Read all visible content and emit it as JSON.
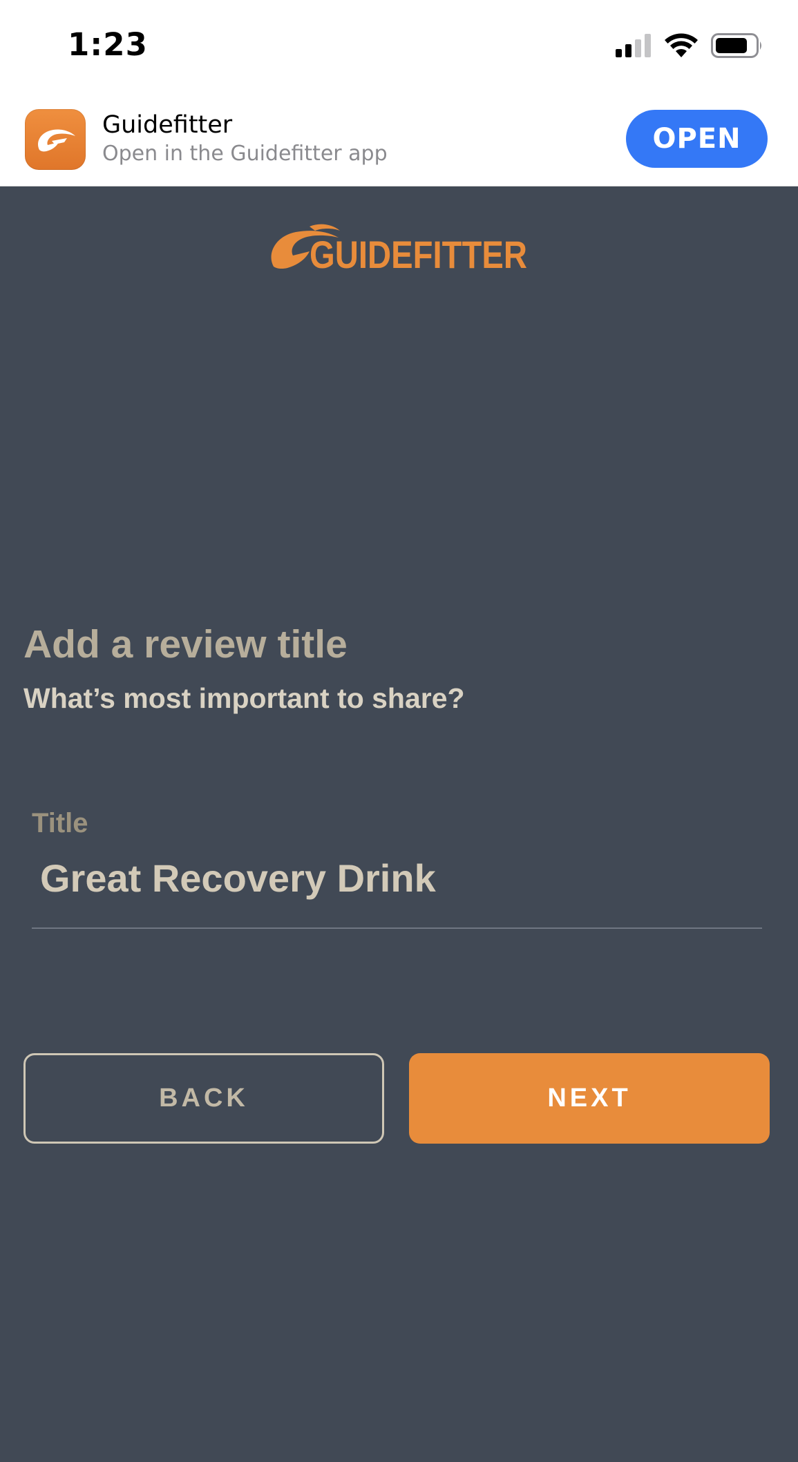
{
  "status_bar": {
    "time": "1:23"
  },
  "banner": {
    "app_name": "Guidefitter",
    "subtitle": "Open in the Guidefitter app",
    "open_label": "OPEN"
  },
  "brand": {
    "logo_text": "GUIDEFITTER",
    "accent_color": "#e88c3b",
    "background_color": "#414955"
  },
  "form": {
    "heading": "Add a review title",
    "subheading": "What’s most important to share?",
    "title_label": "Title",
    "title_value": "Great Recovery Drink"
  },
  "actions": {
    "back_label": "BACK",
    "next_label": "NEXT"
  }
}
